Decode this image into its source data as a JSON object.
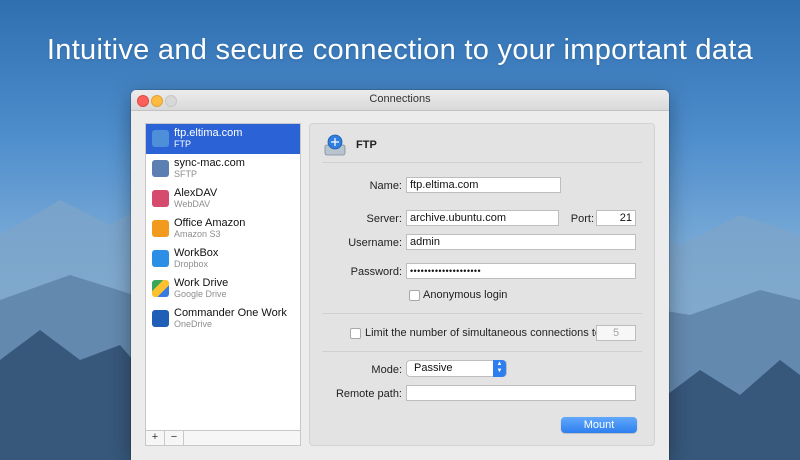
{
  "headline": "Intuitive and secure connection to your important data",
  "window": {
    "title": "Connections"
  },
  "connections": [
    {
      "name": "ftp.eltima.com",
      "protocol": "FTP",
      "icon": "ftp-icon",
      "selected": true
    },
    {
      "name": "sync-mac.com",
      "protocol": "SFTP",
      "icon": "sftp-icon"
    },
    {
      "name": "AlexDAV",
      "protocol": "WebDAV",
      "icon": "webdav-icon"
    },
    {
      "name": "Office Amazon",
      "protocol": "Amazon S3",
      "icon": "amazon-s3-icon"
    },
    {
      "name": "WorkBox",
      "protocol": "Dropbox",
      "icon": "dropbox-icon"
    },
    {
      "name": "Work Drive",
      "protocol": "Google Drive",
      "icon": "google-drive-icon"
    },
    {
      "name": "Commander One Work",
      "protocol": "OneDrive",
      "icon": "onedrive-icon"
    }
  ],
  "sidebar_footer": {
    "add": "+",
    "remove": "−"
  },
  "form": {
    "header": "FTP",
    "name_label": "Name:",
    "name_value": "ftp.eltima.com",
    "server_label": "Server:",
    "server_value": "archive.ubuntu.com",
    "port_label": "Port:",
    "port_value": "21",
    "username_label": "Username:",
    "username_value": "admin",
    "password_label": "Password:",
    "password_value": "••••••••••••••••••••",
    "anonymous_label": "Anonymous login",
    "limit_label": "Limit the number of simultaneous connections to",
    "limit_value": "5",
    "mode_label": "Mode:",
    "mode_value": "Passive",
    "remote_label": "Remote path:",
    "remote_value": "",
    "mount_label": "Mount"
  },
  "colors": {
    "accent": "#2b63d6",
    "button": "#2d7ff0"
  }
}
